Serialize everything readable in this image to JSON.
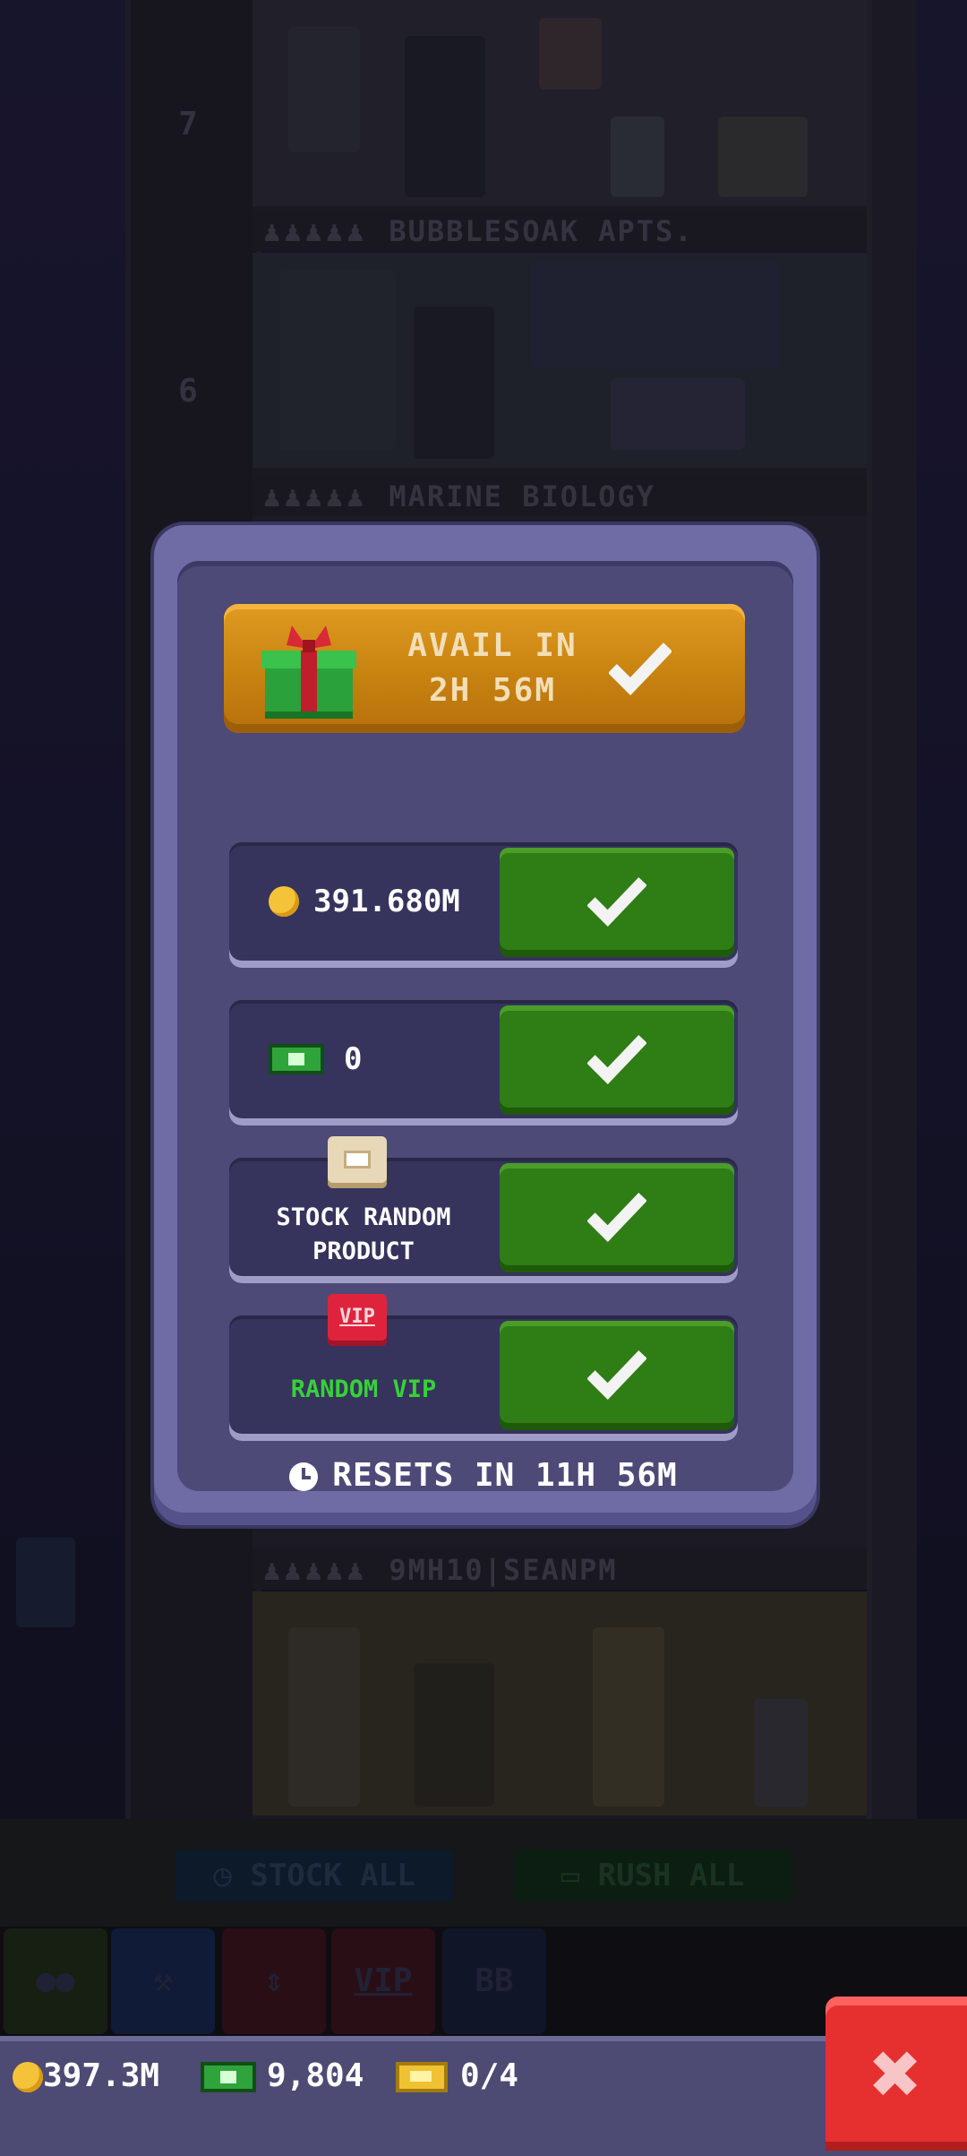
{
  "background": {
    "floor_numbers": [
      "7",
      "6"
    ],
    "floor_labels": [
      {
        "icons": "♟♟♟♟♟",
        "name": "BUBBLESOAK APTS."
      },
      {
        "icons": "♟♟♟♟♟",
        "name": "MARINE BIOLOGY"
      },
      {
        "icons": "♟♟♟♟♟",
        "name": "9MH10|SEANPM"
      }
    ],
    "action_buttons": {
      "stock_all": "STOCK ALL",
      "rush_all": "RUSH ALL"
    },
    "tabs": {
      "vip": "VIP",
      "bb": "BB"
    }
  },
  "modal": {
    "gift": {
      "line1": "AVAIL IN",
      "line2": "2H 56M"
    },
    "rows": {
      "coins": {
        "value": "391.680M"
      },
      "bux": {
        "value": "0"
      },
      "stock": {
        "line1": "STOCK RANDOM",
        "line2": "PRODUCT"
      },
      "vip": {
        "icon_text": "VIP",
        "label": "RANDOM VIP"
      }
    },
    "resets": "RESETS IN 11H 56M"
  },
  "status": {
    "coins": "397.3M",
    "bux": "9,804",
    "tickets": "0/4"
  },
  "icons": {
    "gift": "gift-icon",
    "check": "check-icon",
    "coin": "coin-icon",
    "bux": "bux-icon",
    "box": "box-icon",
    "vip": "vip-icon",
    "clock": "clock-icon",
    "close": "close-icon",
    "ticket": "ticket-icon"
  },
  "colors": {
    "modal_frame": "#6f6ba5",
    "modal_inner": "#4d4a78",
    "gift_bar": "#c88210",
    "action_green": "#2f7d15",
    "vip_label": "#36d13a",
    "close_red": "#e63030"
  }
}
